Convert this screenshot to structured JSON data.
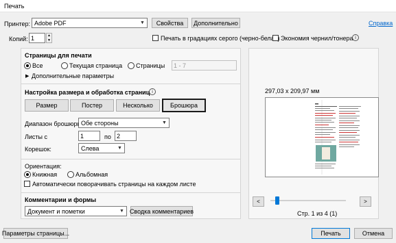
{
  "window": {
    "title": "Печать"
  },
  "printer": {
    "label": "Принтер:",
    "value": "Adobe PDF",
    "properties_button": "Свойства",
    "advanced_button": "Дополнительно",
    "help_link": "Справка"
  },
  "copies": {
    "label": "Копий:",
    "value": "1",
    "grayscale_label": "Печать в градациях серого (черно-белая)",
    "grayscale_checked": false,
    "ink_saver_label": "Экономия чернил/тонера",
    "ink_saver_checked": false
  },
  "pages": {
    "heading": "Страницы для печати",
    "options": [
      "Все",
      "Текущая страница",
      "Страницы"
    ],
    "selected": "Все",
    "range_value": "1 - 7",
    "more_options": "Дополнительные параметры"
  },
  "sizing": {
    "heading": "Настройка размера и обработка страниц",
    "modes": [
      "Размер",
      "Постер",
      "Несколько",
      "Брошюра"
    ],
    "selected_mode": "Брошюра",
    "booklet_range_label": "Диапазон брошюры:",
    "booklet_range_value": "Обе стороны",
    "sheets_from_label": "Листы с",
    "sheets_from_value": "1",
    "sheets_to_label": "по",
    "sheets_to_value": "2",
    "binding_label": "Корешок:",
    "binding_value": "Слева"
  },
  "orientation": {
    "heading": "Ориентация:",
    "portrait": "Книжная",
    "landscape": "Альбомная",
    "selected": "Книжная",
    "auto_rotate_label": "Автоматически поворачивать страницы на каждом листе",
    "auto_rotate_checked": false
  },
  "comments": {
    "heading": "Комментарии и формы",
    "value": "Документ и пометки",
    "summary_button": "Сводка комментариев"
  },
  "preview": {
    "paper_size": "297,03 x 209,97 мм",
    "page_indicator": "Стр. 1 из 4 (1)",
    "current_page": 1,
    "total_pages": 4,
    "prev_label": "<",
    "next_label": ">"
  },
  "footer": {
    "page_setup_button": "Параметры страницы...",
    "print_button": "Печать",
    "cancel_button": "Отмена"
  }
}
